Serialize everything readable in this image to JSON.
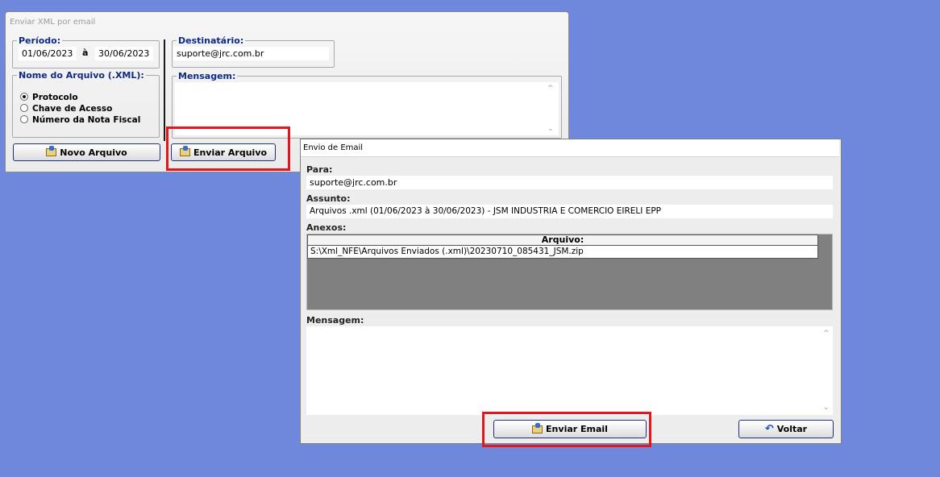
{
  "main_window": {
    "title": "Enviar XML por email",
    "periodo": {
      "label": "Período:",
      "start": "01/06/2023",
      "connector": "à",
      "end": "30/06/2023"
    },
    "nome_arquivo": {
      "label": "Nome do Arquivo (.XML):",
      "options": [
        "Protocolo",
        "Chave de Acesso",
        "Número da Nota Fiscal"
      ],
      "selected": "Protocolo"
    },
    "destinatario": {
      "label": "Destinatário:",
      "value": "suporte@jrc.com.br"
    },
    "mensagem": {
      "label": "Mensagem:",
      "value": ""
    },
    "buttons": {
      "novo_arquivo": "Novo Arquivo",
      "enviar_arquivo": "Enviar Arquivo"
    }
  },
  "email_dialog": {
    "title": "Envio de Email",
    "para_label": "Para:",
    "para_value": "suporte@jrc.com.br",
    "assunto_label": "Assunto:",
    "assunto_value": "Arquivos .xml (01/06/2023 à 30/06/2023) - JSM INDUSTRIA E COMERCIO EIRELI EPP",
    "anexos_label": "Anexos:",
    "anexos_table": {
      "column": "Arquivo:",
      "rows": [
        "S:\\Xml_NFE\\Arquivos Enviados (.xml)\\20230710_085431_JSM.zip"
      ]
    },
    "mensagem_label": "Mensagem:",
    "mensagem_value": "",
    "buttons": {
      "enviar_email": "Enviar Email",
      "voltar": "Voltar"
    }
  },
  "icons": {
    "mail": "mail-send-icon",
    "undo": "undo-arrow-icon",
    "radio": "radio-button-icon",
    "scroll_up": "scroll-up-icon",
    "scroll_down": "scroll-down-icon"
  },
  "colors": {
    "desktop": "#7088dc",
    "group_label": "#0e2a86",
    "highlight": "#e8141c",
    "grid_background": "#808080"
  }
}
